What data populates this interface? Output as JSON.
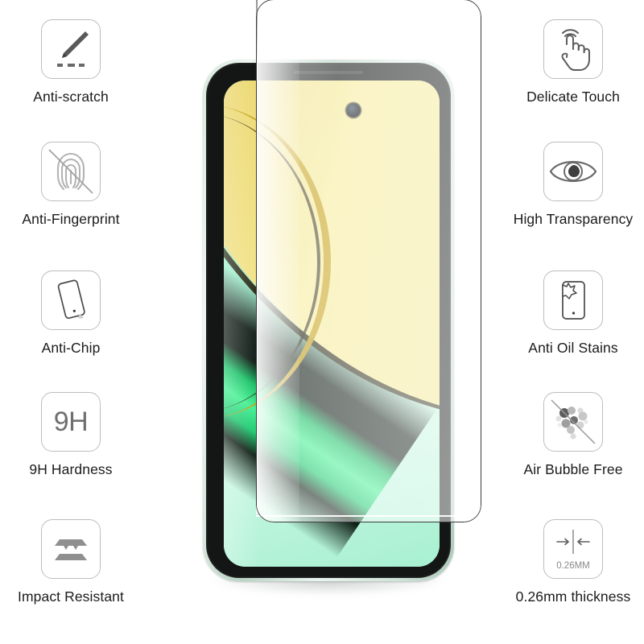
{
  "product": {
    "type": "tempered-glass-screen-protector-infographic",
    "background_color": "#ffffff",
    "icon_border_color": "#bdbdbd",
    "label_color": "#1b1b1b"
  },
  "features_left": [
    {
      "label": "Anti-scratch",
      "icon": "knife-scratch-icon"
    },
    {
      "label": "Anti-Fingerprint",
      "icon": "fingerprint-crossed-icon"
    },
    {
      "label": "Anti-Chip",
      "icon": "tilted-glass-panel-icon"
    },
    {
      "label": "9H Hardness",
      "icon": "hardness-9h-icon",
      "icon_text": "9H"
    },
    {
      "label": "Impact Resistant",
      "icon": "stacked-layers-icon"
    }
  ],
  "features_right": [
    {
      "label": "Delicate Touch",
      "icon": "tapping-hand-icon"
    },
    {
      "label": "High Transparency",
      "icon": "eye-icon"
    },
    {
      "label": "Anti Oil Stains",
      "icon": "phone-oil-splash-icon"
    },
    {
      "label": "Air Bubble Free",
      "icon": "bubbles-crossed-icon"
    },
    {
      "label": "0.26mm thickness",
      "icon": "thickness-arrows-icon",
      "icon_text": "0.26MM"
    }
  ],
  "phone": {
    "name": "smartphone-mockup",
    "frame_color": "#cfe3d7",
    "bezel_color": "#131615",
    "wallpaper": {
      "description": "abstract diagonal gold and mint green gradient",
      "gold_color": "#f3e893",
      "mint_color": "#9aeecb",
      "accent_green": "#3ef08f"
    },
    "camera": "punch-hole-front-camera",
    "earpiece": "earpiece-speaker-slit"
  },
  "glass_overlay": {
    "name": "tempered-glass-protector",
    "description": "transparent tempered glass sheet overlaying the phone screen"
  }
}
